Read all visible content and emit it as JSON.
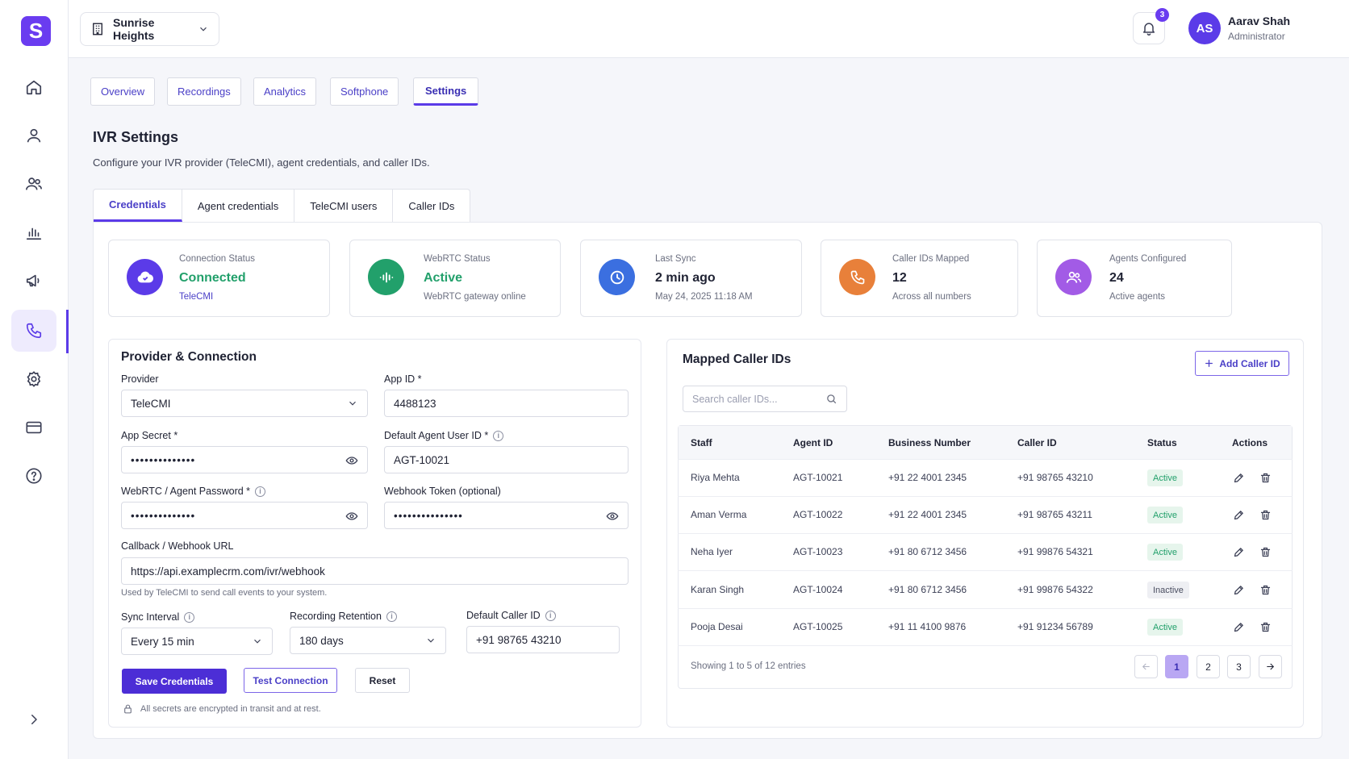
{
  "brand": {
    "logo_letter": "S",
    "accent": "#5b3be8"
  },
  "topbar": {
    "property": "Sunrise Heights",
    "notifications": "3",
    "user": {
      "initials": "AS",
      "name": "Aarav Shah",
      "role": "Administrator"
    }
  },
  "sidebar": {
    "items": [
      {
        "name": "home-icon"
      },
      {
        "name": "user-icon"
      },
      {
        "name": "users-icon"
      },
      {
        "name": "bar-chart-icon"
      },
      {
        "name": "megaphone-icon"
      },
      {
        "name": "phone-icon",
        "active": true
      },
      {
        "name": "gear-icon"
      },
      {
        "name": "credit-card-icon"
      },
      {
        "name": "help-icon"
      }
    ],
    "expand": "chevron-right-icon"
  },
  "page_tabs": [
    "Overview",
    "Recordings",
    "Analytics",
    "Softphone",
    "Settings"
  ],
  "page": {
    "title": "IVR Settings",
    "subtitle": "Configure your IVR provider (TeleCMI), agent credentials, and caller IDs."
  },
  "sub_tabs": [
    "Credentials",
    "Agent credentials",
    "TeleCMI users",
    "Caller IDs"
  ],
  "stats": [
    {
      "label": "Connection Status",
      "value": "Connected",
      "foot": "TeleCMI",
      "color": "#5b3be8"
    },
    {
      "label": "WebRTC Status",
      "value": "Active",
      "foot": "WebRTC gateway online",
      "color": "#22a06b"
    },
    {
      "label": "Last Sync",
      "value": "2 min ago",
      "foot": "May 24, 2025 11:18 AM",
      "color": "#3b6fe0"
    },
    {
      "label": "Caller IDs Mapped",
      "value": "12",
      "foot": "Across all numbers",
      "color": "#e8803a"
    },
    {
      "label": "Agents Configured",
      "value": "24",
      "foot": "Active agents",
      "color": "#a25be6"
    }
  ],
  "provider": {
    "title": "Provider & Connection",
    "provider_label": "Provider",
    "provider_value": "TeleCMI",
    "app_id_label": "App ID *",
    "app_id_value": "4488123",
    "app_secret_label": "App Secret *",
    "app_secret_value": "••••••••••••••",
    "default_agent_label": "Default Agent User ID *",
    "default_agent_value": "AGT-10021",
    "webrtc_label": "WebRTC / Agent Password *",
    "webrtc_value": "••••••••••••••",
    "webhook_token_label": "Webhook Token (optional)",
    "webhook_token_value": "•••••••••••••••",
    "callback_label": "Callback / Webhook URL",
    "callback_value": "https://api.examplecrm.com/ivr/webhook",
    "callback_hint": "Used by TeleCMI to send call events to your system.",
    "sync_label": "Sync Interval",
    "sync_value": "Every 15 min",
    "retention_label": "Recording Retention",
    "retention_value": "180 days",
    "caller_label": "Default Caller ID",
    "caller_value": "+91 98765 43210",
    "save": "Save Credentials",
    "test": "Test Connection",
    "reset": "Reset",
    "secure_note": "All secrets are encrypted in transit and at rest."
  },
  "callers": {
    "title": "Mapped Caller IDs",
    "add_button": "Add Caller ID",
    "search_placeholder": "Search caller IDs...",
    "columns": [
      "Staff",
      "Agent ID",
      "Business Number",
      "Caller ID",
      "Status",
      "Actions"
    ],
    "rows": [
      {
        "staff": "Riya Mehta",
        "agent": "AGT-10021",
        "business": "+91 22 4001 2345",
        "caller": "+91 98765 43210",
        "status": "Active"
      },
      {
        "staff": "Aman Verma",
        "agent": "AGT-10022",
        "business": "+91 22 4001 2345",
        "caller": "+91 98765 43211",
        "status": "Active"
      },
      {
        "staff": "Neha Iyer",
        "agent": "AGT-10023",
        "business": "+91 80 6712 3456",
        "caller": "+91 99876 54321",
        "status": "Active"
      },
      {
        "staff": "Karan Singh",
        "agent": "AGT-10024",
        "business": "+91 80 6712 3456",
        "caller": "+91 99876 54322",
        "status": "Inactive"
      },
      {
        "staff": "Pooja Desai",
        "agent": "AGT-10025",
        "business": "+91 11 4100 9876",
        "caller": "+91 91234 56789",
        "status": "Active"
      }
    ],
    "footer": "Showing 1 to 5 of 12 entries",
    "pages": [
      "1",
      "2",
      "3"
    ],
    "current_page": "1"
  }
}
